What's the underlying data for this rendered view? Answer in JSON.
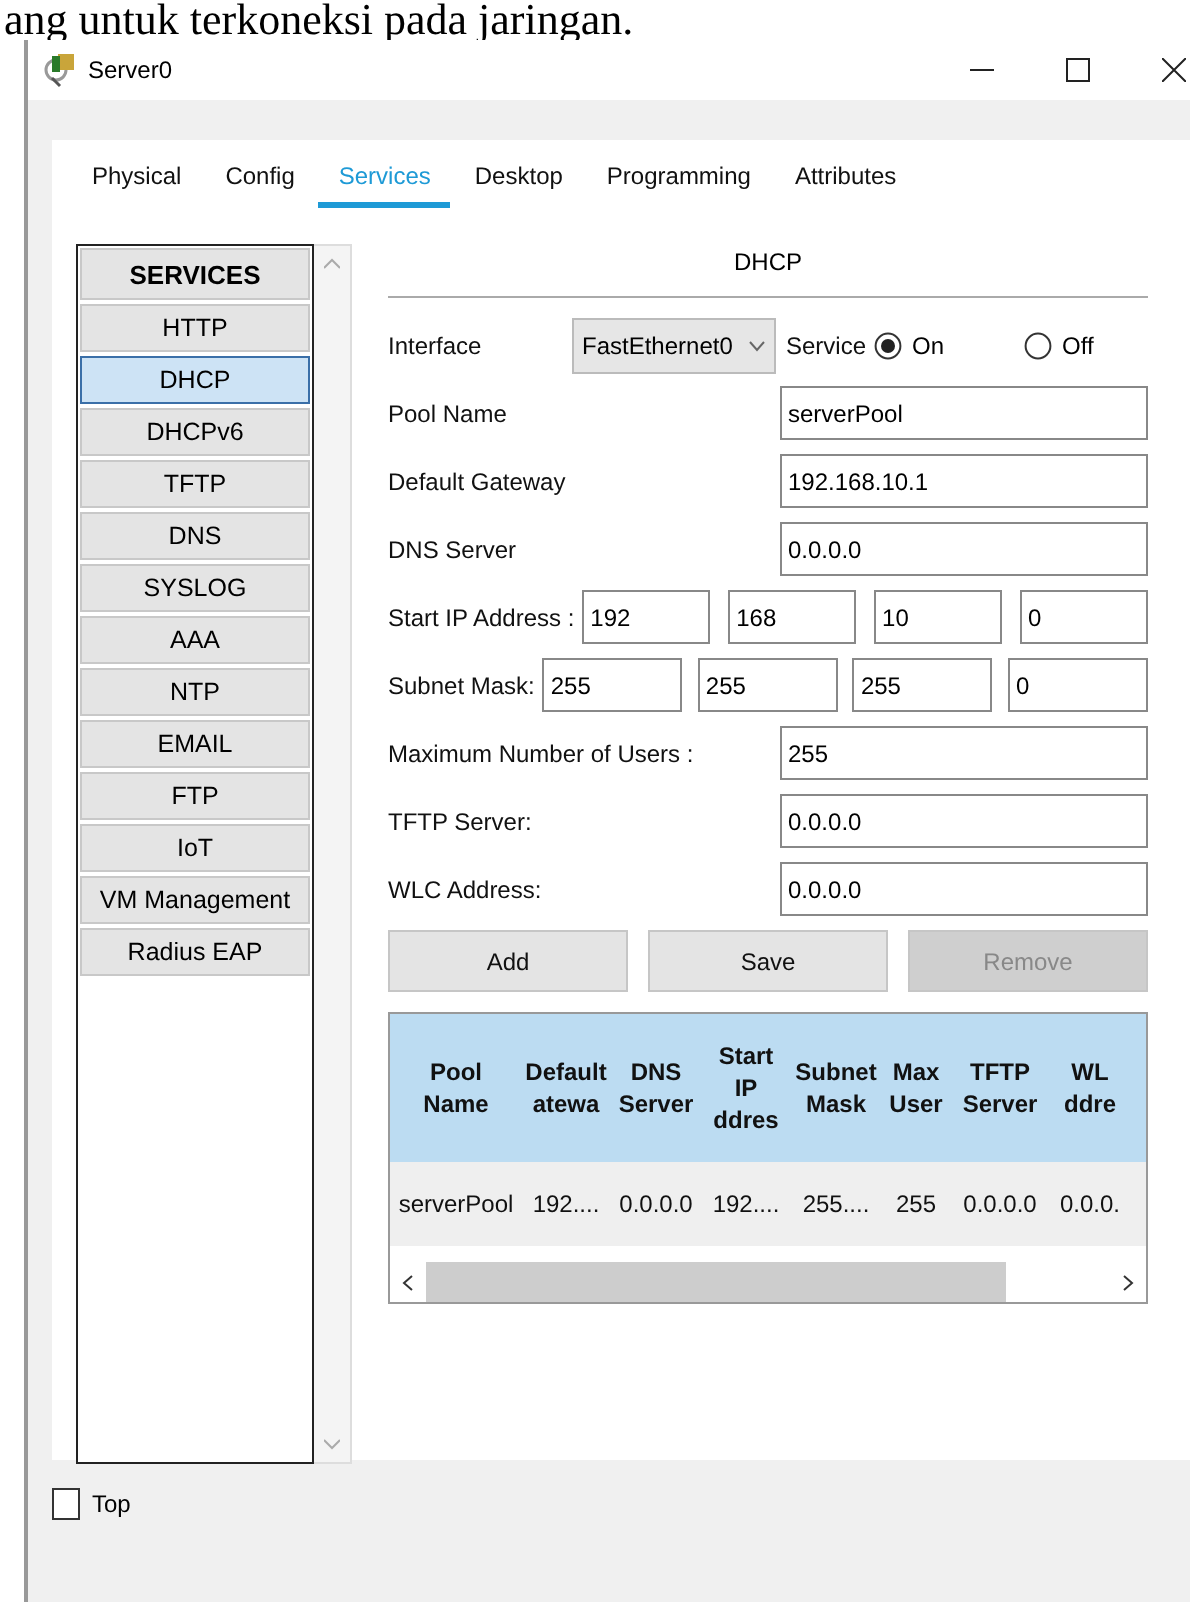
{
  "document_text": "ang untuk terkoneksi pada jaringan.",
  "window": {
    "title": "Server0"
  },
  "tabs": [
    {
      "label": "Physical",
      "selected": false
    },
    {
      "label": "Config",
      "selected": false
    },
    {
      "label": "Services",
      "selected": true
    },
    {
      "label": "Desktop",
      "selected": false
    },
    {
      "label": "Programming",
      "selected": false
    },
    {
      "label": "Attributes",
      "selected": false
    }
  ],
  "services": {
    "header": "SERVICES",
    "items": [
      {
        "label": "HTTP",
        "selected": false
      },
      {
        "label": "DHCP",
        "selected": true
      },
      {
        "label": "DHCPv6",
        "selected": false
      },
      {
        "label": "TFTP",
        "selected": false
      },
      {
        "label": "DNS",
        "selected": false
      },
      {
        "label": "SYSLOG",
        "selected": false
      },
      {
        "label": "AAA",
        "selected": false
      },
      {
        "label": "NTP",
        "selected": false
      },
      {
        "label": "EMAIL",
        "selected": false
      },
      {
        "label": "FTP",
        "selected": false
      },
      {
        "label": "IoT",
        "selected": false
      },
      {
        "label": "VM Management",
        "selected": false
      },
      {
        "label": "Radius EAP",
        "selected": false
      }
    ]
  },
  "dhcp": {
    "title": "DHCP",
    "interface_label": "Interface",
    "interface_value": "FastEthernet0",
    "service_label": "Service",
    "service_options": [
      {
        "label": "On",
        "selected": true
      },
      {
        "label": "Off",
        "selected": false
      }
    ],
    "fields_top": [
      {
        "label": "Pool Name",
        "value": "serverPool"
      },
      {
        "label": "Default Gateway",
        "value": "192.168.10.1"
      },
      {
        "label": "DNS Server",
        "value": "0.0.0.0"
      }
    ],
    "start_ip": {
      "label": "Start IP Address :",
      "octets": [
        "192",
        "168",
        "10",
        "0"
      ]
    },
    "subnet_mask": {
      "label": "Subnet Mask:",
      "octets": [
        "255",
        "255",
        "255",
        "0"
      ]
    },
    "fields_bottom": [
      {
        "label": "Maximum Number of Users :",
        "value": "255"
      },
      {
        "label": "TFTP Server:",
        "value": "0.0.0.0"
      },
      {
        "label": "WLC Address:",
        "value": "0.0.0.0"
      }
    ],
    "buttons": [
      {
        "label": "Add",
        "disabled": false
      },
      {
        "label": "Save",
        "disabled": false
      },
      {
        "label": "Remove",
        "disabled": true
      }
    ],
    "table": {
      "columns": [
        "Pool\nName",
        "Default\natewa",
        "DNS\nServer",
        "Start\nIP\nddres",
        "Subnet\nMask",
        "Max\nUser",
        "TFTP\nServer",
        "WL\nddre"
      ],
      "rows": [
        [
          "serverPool",
          "192....",
          "0.0.0.0",
          "192....",
          "255....",
          "255",
          "0.0.0.0",
          "0.0.0."
        ]
      ]
    }
  },
  "top_checkbox": {
    "label": "Top",
    "checked": false
  }
}
